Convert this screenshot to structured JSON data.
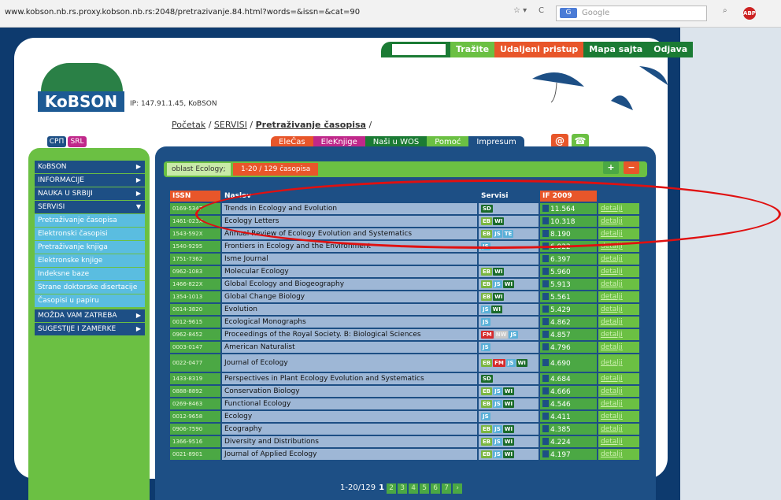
{
  "browser": {
    "url": "www.kobson.nb.rs.proxy.kobson.nb.rs:2048/pretrazivanje.84.html?words=&issn=&cat=90",
    "search_placeholder": "Google",
    "search_engine_badge": "G"
  },
  "topnav": {
    "search_label": "Tražite",
    "remote_label": "Udaljeni pristup",
    "sitemap_label": "Mapa sajta",
    "logout_label": "Odjava"
  },
  "logo": {
    "text": "KoBSON"
  },
  "ip_text": "IP: 147.91.1.45, KoBSON",
  "breadcrumb": {
    "home": "Početak",
    "sep1": " / ",
    "servisi": "SERVISI",
    "sep2": " / ",
    "current": "Pretraživanje časopisa",
    "sep3": " /"
  },
  "lang": {
    "cyr": "СРП",
    "lat": "SRL"
  },
  "tabs": {
    "elecas": "ElеČas",
    "eleknjige": "EleKnjige",
    "nasi_wos": "Naši u WOS",
    "pomoc": "Pomoć",
    "impresum": "Impresum"
  },
  "icons": {
    "at": "@",
    "phone": "☎",
    "plus": "+",
    "minus": "−"
  },
  "sidebar": {
    "items": [
      {
        "label": "KoBSON"
      },
      {
        "label": "INFORMACIJE"
      },
      {
        "label": "NAUKA U SRBIJI"
      },
      {
        "label": "SERVISI"
      }
    ],
    "subitems": [
      {
        "label": "Pretraživanje časopisa"
      },
      {
        "label": "Elektronski časopisi"
      },
      {
        "label": "Pretraživanje knjiga"
      },
      {
        "label": "Elektronske knjige"
      },
      {
        "label": "Indeksne baze"
      },
      {
        "label": "Strane doktorske disertacije"
      },
      {
        "label": "Časopisi u papiru"
      }
    ],
    "bottom": [
      {
        "label": "MOŽDA VAM ZATREBA"
      },
      {
        "label": "SUGESTIJE I ZAMERKE"
      }
    ]
  },
  "filter": {
    "area": "oblast Ecology;",
    "count": "1-20 / 129 časopisa"
  },
  "table": {
    "headers": {
      "issn": "ISSN",
      "naslov": "Naslov",
      "servisi": "Servisi",
      "if": "IF 2009"
    },
    "detail_label": "detalji",
    "rows": [
      {
        "issn": "0169-5347",
        "title": "Trends in Ecology and Evolution",
        "services": [
          "SD"
        ],
        "if": "11.564"
      },
      {
        "issn": "1461-023X",
        "title": "Ecology Letters",
        "services": [
          "EB",
          "WI"
        ],
        "if": "10.318"
      },
      {
        "issn": "1543-592X",
        "title": "Annual Review of Ecology Evolution and Systematics",
        "services": [
          "EB",
          "JS",
          "TE"
        ],
        "if": "8.190"
      },
      {
        "issn": "1540-9295",
        "title": "Frontiers in Ecology and the Environment",
        "services": [
          "JS"
        ],
        "if": "6.922"
      },
      {
        "issn": "1751-7362",
        "title": "Isme Journal",
        "services": [],
        "if": "6.397"
      },
      {
        "issn": "0962-1083",
        "title": "Molecular Ecology",
        "services": [
          "EB",
          "WI"
        ],
        "if": "5.960"
      },
      {
        "issn": "1466-822X",
        "title": "Global Ecology and Biogeography",
        "services": [
          "EB",
          "JS",
          "WI"
        ],
        "if": "5.913"
      },
      {
        "issn": "1354-1013",
        "title": "Global Change Biology",
        "services": [
          "EB",
          "WI"
        ],
        "if": "5.561"
      },
      {
        "issn": "0014-3820",
        "title": "Evolution",
        "services": [
          "JS",
          "WI"
        ],
        "if": "5.429"
      },
      {
        "issn": "0012-9615",
        "title": "Ecological Monographs",
        "services": [
          "JS"
        ],
        "if": "4.862"
      },
      {
        "issn": "0962-8452",
        "title": "Proceedings of the Royal Society. B: Biological Sciences",
        "services": [
          "FM",
          "NW",
          "JS"
        ],
        "if": "4.857"
      },
      {
        "issn": "0003-0147",
        "title": "American Naturalist",
        "services": [
          "JS"
        ],
        "if": "4.796"
      },
      {
        "issn": "0022-0477",
        "title": "Journal of Ecology",
        "services": [
          "EB",
          "FM",
          "JS",
          "WI"
        ],
        "if": "4.690"
      },
      {
        "issn": "1433-8319",
        "title": "Perspectives in Plant Ecology Evolution and Systematics",
        "services": [
          "SD"
        ],
        "if": "4.684"
      },
      {
        "issn": "0888-8892",
        "title": "Conservation Biology",
        "services": [
          "EB",
          "JS",
          "WI"
        ],
        "if": "4.666"
      },
      {
        "issn": "0269-8463",
        "title": "Functional Ecology",
        "services": [
          "EB",
          "JS",
          "WI"
        ],
        "if": "4.546"
      },
      {
        "issn": "0012-9658",
        "title": "Ecology",
        "services": [
          "JS"
        ],
        "if": "4.411"
      },
      {
        "issn": "0906-7590",
        "title": "Ecography",
        "services": [
          "EB",
          "JS",
          "WI"
        ],
        "if": "4.385"
      },
      {
        "issn": "1366-9516",
        "title": "Diversity and Distributions",
        "services": [
          "EB",
          "JS",
          "WI"
        ],
        "if": "4.224"
      },
      {
        "issn": "0021-8901",
        "title": "Journal of Applied Ecology",
        "services": [
          "EB",
          "JS",
          "WI"
        ],
        "if": "4.197"
      }
    ]
  },
  "pager": {
    "range": "1-20/129",
    "current": "1",
    "pages": [
      "2",
      "3",
      "4",
      "5",
      "6",
      "7"
    ],
    "next": "›"
  },
  "colors": {
    "navy": "#1d4f85",
    "green": "#6bc043",
    "orange": "#e8562a",
    "dark_green": "#1b7b34",
    "highlight": "#e01010"
  }
}
